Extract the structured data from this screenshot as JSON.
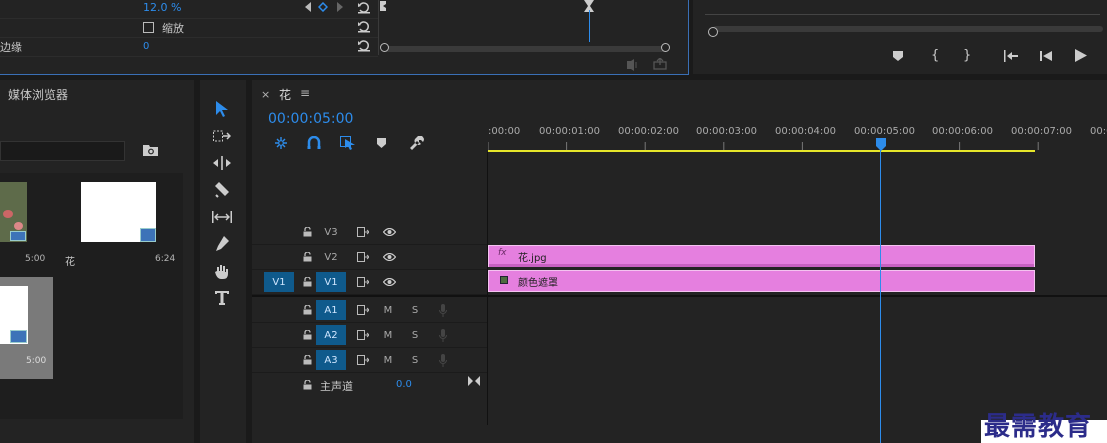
{
  "effect_controls": {
    "rows": [
      {
        "label": "",
        "value": "12.0 %"
      },
      {
        "label": "",
        "value": "",
        "checkbox_label": "缩放"
      },
      {
        "label": "边缘",
        "value": "0"
      }
    ]
  },
  "project": {
    "tab_title": "媒体浏览器",
    "items": [
      {
        "name": "",
        "duration": "5:00"
      },
      {
        "name": "花",
        "duration": "6:24"
      },
      {
        "name": "",
        "duration": "5:00"
      }
    ]
  },
  "tools": [
    "selection-tool",
    "track-select-tool",
    "ripple-edit-tool",
    "razor-tool",
    "slip-tool",
    "pen-tool",
    "hand-tool",
    "type-tool"
  ],
  "timeline": {
    "tab_close": "×",
    "tab_title": "花",
    "tab_menu": "≡",
    "timecode": "00:00:05:00",
    "ruler": [
      ":00:00",
      "00:00:01:00",
      "00:00:02:00",
      "00:00:03:00",
      "00:00:04:00",
      "00:00:05:00",
      "00:00:06:00",
      "00:00:07:00",
      "00:0"
    ],
    "video_tracks": [
      {
        "name": "V3",
        "source": ""
      },
      {
        "name": "V2",
        "source": ""
      },
      {
        "name": "V1",
        "source": "V1"
      }
    ],
    "audio_tracks": [
      {
        "name": "A1",
        "m": "M",
        "s": "S"
      },
      {
        "name": "A2",
        "m": "M",
        "s": "S"
      },
      {
        "name": "A3",
        "m": "M",
        "s": "S"
      }
    ],
    "master": {
      "label": "主声道",
      "value": "0.0"
    },
    "clips": [
      {
        "fx": "fx",
        "name": "花.jpg"
      },
      {
        "fx": "",
        "name": "颜色遮罩"
      }
    ]
  },
  "watermark": "最需教育",
  "colors": {
    "accent": "#2d8ceb",
    "clip": "#e57fdf",
    "playhead": "#2d8ceb",
    "work_area": "#e6e62a"
  }
}
